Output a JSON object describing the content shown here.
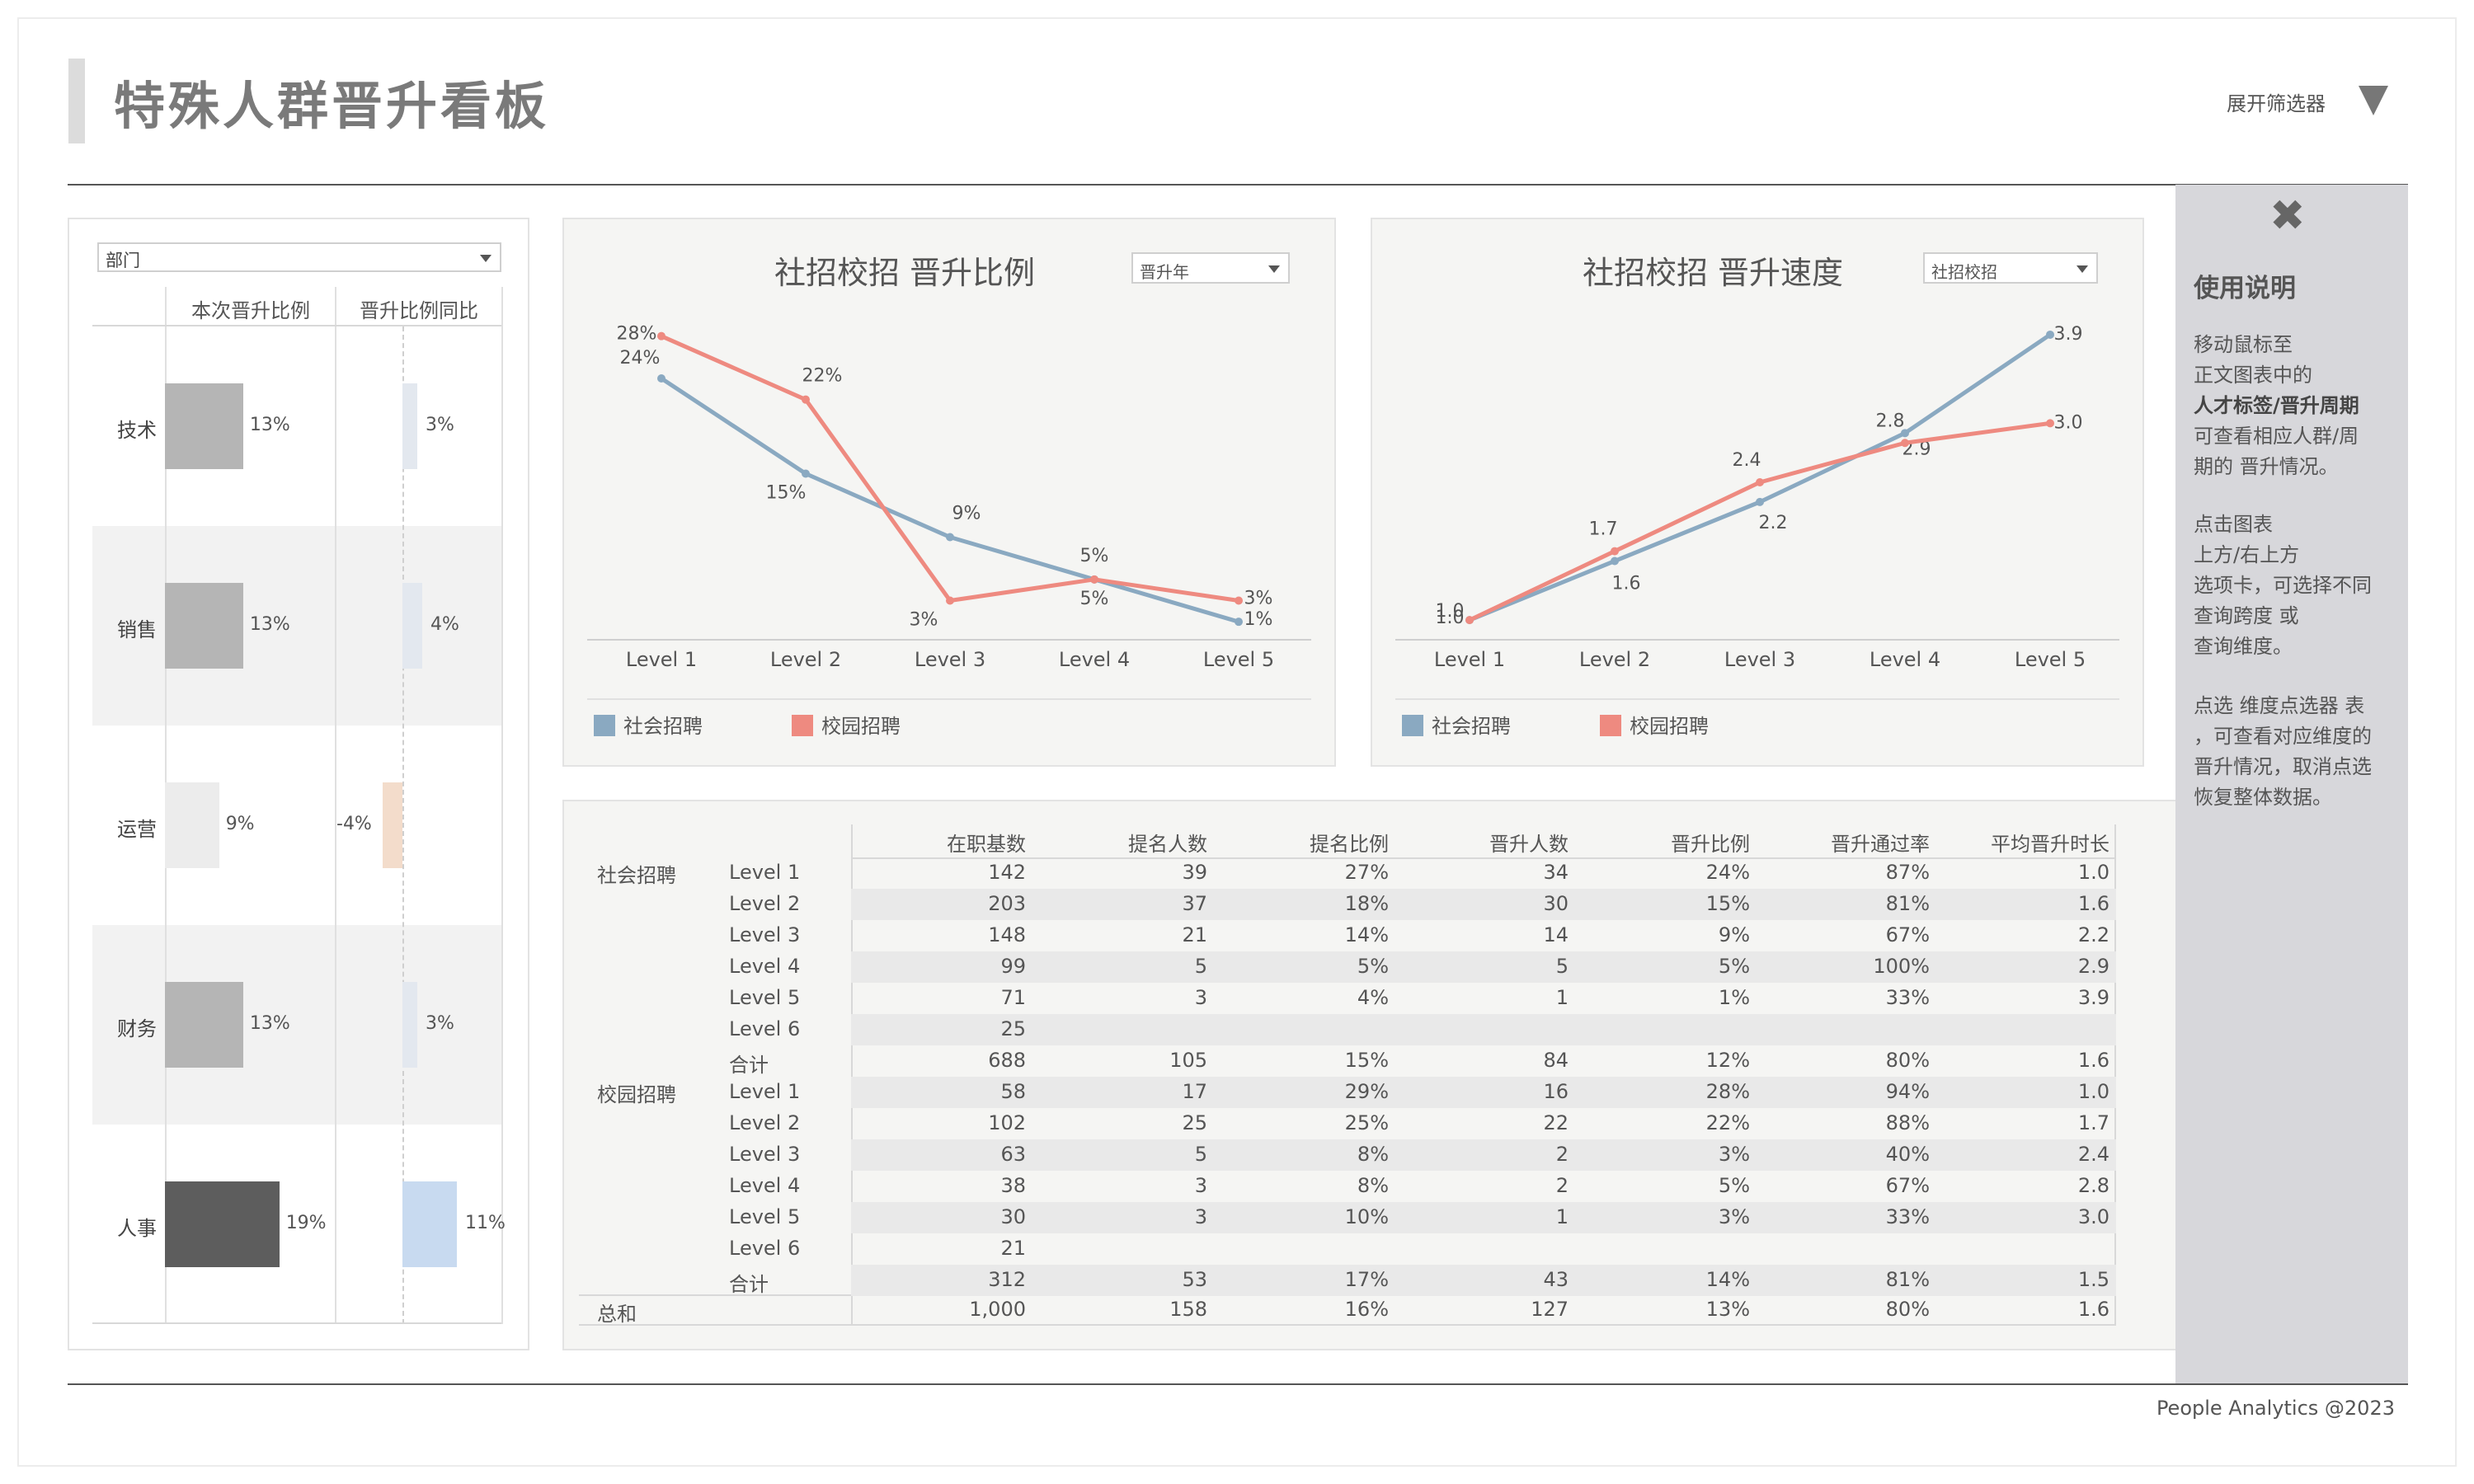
{
  "header": {
    "title": "特殊人群晋升看板",
    "filter_toggle_label": "展开筛选器"
  },
  "left_panel": {
    "dept_select": "部门",
    "col1": "本次晋升比例",
    "col2": "晋升比例同比",
    "rows": [
      {
        "dept": "技术",
        "ratio": 13,
        "ratio_label": "13%",
        "yoy": 3,
        "yoy_label": "3%"
      },
      {
        "dept": "销售",
        "ratio": 13,
        "ratio_label": "13%",
        "yoy": 4,
        "yoy_label": "4%"
      },
      {
        "dept": "运营",
        "ratio": 9,
        "ratio_label": "9%",
        "yoy": -4,
        "yoy_label": "-4%"
      },
      {
        "dept": "财务",
        "ratio": 13,
        "ratio_label": "13%",
        "yoy": 3,
        "yoy_label": "3%"
      },
      {
        "dept": "人事",
        "ratio": 19,
        "ratio_label": "19%",
        "yoy": 11,
        "yoy_label": "11%"
      }
    ]
  },
  "chart1": {
    "title": "社招校招 晋升比例",
    "select": "晋升年",
    "legend": [
      "社会招聘",
      "校园招聘"
    ]
  },
  "chart2": {
    "title": "社招校招 晋升速度",
    "select": "社招校招",
    "legend": [
      "社会招聘",
      "校园招聘"
    ]
  },
  "chart_data": [
    {
      "type": "line",
      "title": "社招校招 晋升比例",
      "categories": [
        "Level 1",
        "Level 2",
        "Level 3",
        "Level 4",
        "Level 5"
      ],
      "series": [
        {
          "name": "社会招聘",
          "values": [
            24,
            15,
            9,
            5,
            1
          ],
          "labels": [
            "24%",
            "15%",
            "9%",
            "5%",
            "1%"
          ],
          "color": "#8aa9c1"
        },
        {
          "name": "校园招聘",
          "values": [
            28,
            22,
            3,
            5,
            3
          ],
          "labels": [
            "28%",
            "22%",
            "3%",
            "5%",
            "3%"
          ],
          "color": "#ee8a80"
        }
      ],
      "ylim": [
        0,
        30
      ],
      "legend_position": "bottom"
    },
    {
      "type": "line",
      "title": "社招校招 晋升速度",
      "categories": [
        "Level 1",
        "Level 2",
        "Level 3",
        "Level 4",
        "Level 5"
      ],
      "series": [
        {
          "name": "社会招聘",
          "values": [
            1.0,
            1.6,
            2.2,
            2.9,
            3.9
          ],
          "labels": [
            "1.0",
            "1.6",
            "2.2",
            "2.9",
            "3.9"
          ],
          "color": "#8aa9c1"
        },
        {
          "name": "校园招聘",
          "values": [
            1.0,
            1.7,
            2.4,
            2.8,
            3.0
          ],
          "labels": [
            "1.0",
            "1.7",
            "2.4",
            "2.8",
            "3.0"
          ],
          "color": "#ee8a80"
        }
      ],
      "ylim": [
        0.8,
        4.0
      ],
      "legend_position": "bottom"
    }
  ],
  "table": {
    "columns": [
      "在职基数",
      "提名人数",
      "提名比例",
      "晋升人数",
      "晋升比例",
      "晋升通过率",
      "平均晋升时长"
    ],
    "groups": [
      {
        "name": "社会招聘",
        "rows": [
          {
            "level": "Level 1",
            "cells": [
              "142",
              "39",
              "27%",
              "34",
              "24%",
              "87%",
              "1.0"
            ]
          },
          {
            "level": "Level 2",
            "cells": [
              "203",
              "37",
              "18%",
              "30",
              "15%",
              "81%",
              "1.6"
            ]
          },
          {
            "level": "Level 3",
            "cells": [
              "148",
              "21",
              "14%",
              "14",
              "9%",
              "67%",
              "2.2"
            ]
          },
          {
            "level": "Level 4",
            "cells": [
              "99",
              "5",
              "5%",
              "5",
              "5%",
              "100%",
              "2.9"
            ]
          },
          {
            "level": "Level 5",
            "cells": [
              "71",
              "3",
              "4%",
              "1",
              "1%",
              "33%",
              "3.9"
            ]
          },
          {
            "level": "Level 6",
            "cells": [
              "25",
              "",
              "",
              "",
              "",
              "",
              ""
            ]
          },
          {
            "level": "合计",
            "cells": [
              "688",
              "105",
              "15%",
              "84",
              "12%",
              "80%",
              "1.6"
            ]
          }
        ]
      },
      {
        "name": "校园招聘",
        "rows": [
          {
            "level": "Level 1",
            "cells": [
              "58",
              "17",
              "29%",
              "16",
              "28%",
              "94%",
              "1.0"
            ]
          },
          {
            "level": "Level 2",
            "cells": [
              "102",
              "25",
              "25%",
              "22",
              "22%",
              "88%",
              "1.7"
            ]
          },
          {
            "level": "Level 3",
            "cells": [
              "63",
              "5",
              "8%",
              "2",
              "3%",
              "40%",
              "2.4"
            ]
          },
          {
            "level": "Level 4",
            "cells": [
              "38",
              "3",
              "8%",
              "2",
              "5%",
              "67%",
              "2.8"
            ]
          },
          {
            "level": "Level 5",
            "cells": [
              "30",
              "3",
              "10%",
              "1",
              "3%",
              "33%",
              "3.0"
            ]
          },
          {
            "level": "Level 6",
            "cells": [
              "21",
              "",
              "",
              "",
              "",
              "",
              ""
            ]
          },
          {
            "level": "合计",
            "cells": [
              "312",
              "53",
              "17%",
              "43",
              "14%",
              "81%",
              "1.5"
            ]
          }
        ]
      }
    ],
    "total": {
      "label": "总和",
      "cells": [
        "1,000",
        "158",
        "16%",
        "127",
        "13%",
        "80%",
        "1.6"
      ]
    }
  },
  "sidebar": {
    "title": "使用说明",
    "p1_a": "移动鼠标至",
    "p1_b": "正文图表中的",
    "p1_bold": "人才标签/晋升周期",
    "p1_c": "可查看相应人群/周",
    "p1_d": "期的 晋升情况。",
    "p2_a": "点击图表",
    "p2_b": "上方/右上方",
    "p2_c": "选项卡，可选择不同",
    "p2_d": "查询跨度 或",
    "p2_e": "查询维度。",
    "p3_a": "点选 维度点选器 表",
    "p3_b": "，可查看对应维度的",
    "p3_c": "晋升情况，取消点选",
    "p3_d": "恢复整体数据。"
  },
  "footer": "People Analytics @2023",
  "colors": {
    "social": "#8aa9c1",
    "campus": "#ee8a80",
    "bar_gray": "#b5b5b5",
    "bar_dark": "#5d5d5d",
    "yoy_blue": "#c8daf0",
    "yoy_peach": "#f3dccb"
  }
}
